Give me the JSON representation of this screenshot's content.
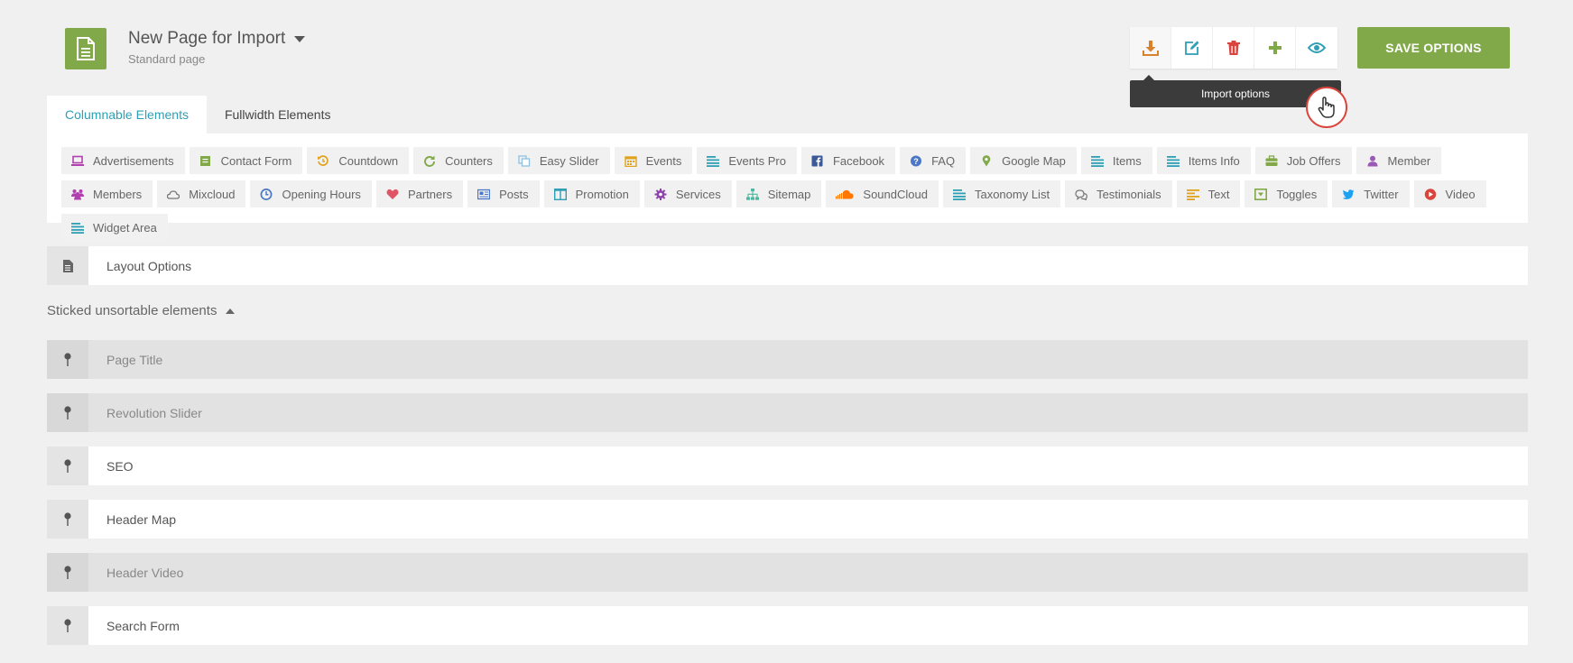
{
  "header": {
    "title": "New Page for Import",
    "subtitle": "Standard page",
    "save_label": "SAVE OPTIONS",
    "tooltip": "Import options"
  },
  "toolbar": [
    {
      "name": "import-icon",
      "color": "#d9822b"
    },
    {
      "name": "edit-icon",
      "color": "#2e9fb5"
    },
    {
      "name": "trash-icon",
      "color": "#d9453c"
    },
    {
      "name": "plus-icon",
      "color": "#81a94a"
    },
    {
      "name": "eye-icon",
      "color": "#2e9fb5"
    }
  ],
  "tabs": [
    {
      "label": "Columnable Elements",
      "active": true
    },
    {
      "label": "Fullwidth Elements",
      "active": false
    }
  ],
  "elements": [
    {
      "label": "Advertisements",
      "icon": "laptop-icon",
      "color": "#b13fb0"
    },
    {
      "label": "Contact Form",
      "icon": "form-icon",
      "color": "#81a94a"
    },
    {
      "label": "Countdown",
      "icon": "history-icon",
      "color": "#e0a21a"
    },
    {
      "label": "Counters",
      "icon": "refresh-icon",
      "color": "#81a94a"
    },
    {
      "label": "Easy Slider",
      "icon": "copy-icon",
      "color": "#8fc1e0"
    },
    {
      "label": "Events",
      "icon": "calendar-icon",
      "color": "#e0a21a"
    },
    {
      "label": "Events Pro",
      "icon": "lines-icon",
      "color": "#2e9fb5"
    },
    {
      "label": "Facebook",
      "icon": "facebook-icon",
      "color": "#3b5998"
    },
    {
      "label": "FAQ",
      "icon": "question-icon",
      "color": "#4a78c6"
    },
    {
      "label": "Google Map",
      "icon": "map-pin-icon",
      "color": "#81a94a"
    },
    {
      "label": "Items",
      "icon": "lines-icon",
      "color": "#2e9fb5"
    },
    {
      "label": "Items Info",
      "icon": "lines-icon",
      "color": "#2e9fb5"
    },
    {
      "label": "Job Offers",
      "icon": "briefcase-icon",
      "color": "#81a94a"
    },
    {
      "label": "Member",
      "icon": "user-icon",
      "color": "#9b59b6"
    },
    {
      "label": "Members",
      "icon": "users-icon",
      "color": "#b13fb0"
    },
    {
      "label": "Mixcloud",
      "icon": "cloud-icon",
      "color": "#777777"
    },
    {
      "label": "Opening Hours",
      "icon": "clock-icon",
      "color": "#4a78c6"
    },
    {
      "label": "Partners",
      "icon": "heart-icon",
      "color": "#e05565"
    },
    {
      "label": "Posts",
      "icon": "newspaper-icon",
      "color": "#4a78c6"
    },
    {
      "label": "Promotion",
      "icon": "columns-icon",
      "color": "#2e9fb5"
    },
    {
      "label": "Services",
      "icon": "cog-icon",
      "color": "#8e44ad"
    },
    {
      "label": "Sitemap",
      "icon": "sitemap-icon",
      "color": "#4cb8a0"
    },
    {
      "label": "SoundCloud",
      "icon": "soundcloud-icon",
      "color": "#ff7700"
    },
    {
      "label": "Taxonomy List",
      "icon": "lines-icon",
      "color": "#2e9fb5"
    },
    {
      "label": "Testimonials",
      "icon": "comments-icon",
      "color": "#777777"
    },
    {
      "label": "Text",
      "icon": "text-lines-icon",
      "color": "#e0a21a"
    },
    {
      "label": "Toggles",
      "icon": "toggle-icon",
      "color": "#81a94a"
    },
    {
      "label": "Twitter",
      "icon": "twitter-icon",
      "color": "#1da1f2"
    },
    {
      "label": "Video",
      "icon": "play-icon",
      "color": "#d9453c"
    },
    {
      "label": "Widget Area",
      "icon": "lines-icon",
      "color": "#2e9fb5"
    }
  ],
  "layout_options": {
    "label": "Layout Options"
  },
  "sticked": {
    "label": "Sticked unsortable elements"
  },
  "rows": [
    {
      "label": "Page Title",
      "disabled": true
    },
    {
      "label": "Revolution Slider",
      "disabled": true
    },
    {
      "label": "SEO",
      "disabled": false
    },
    {
      "label": "Header Map",
      "disabled": false
    },
    {
      "label": "Header Video",
      "disabled": true
    },
    {
      "label": "Search Form",
      "disabled": false
    }
  ]
}
